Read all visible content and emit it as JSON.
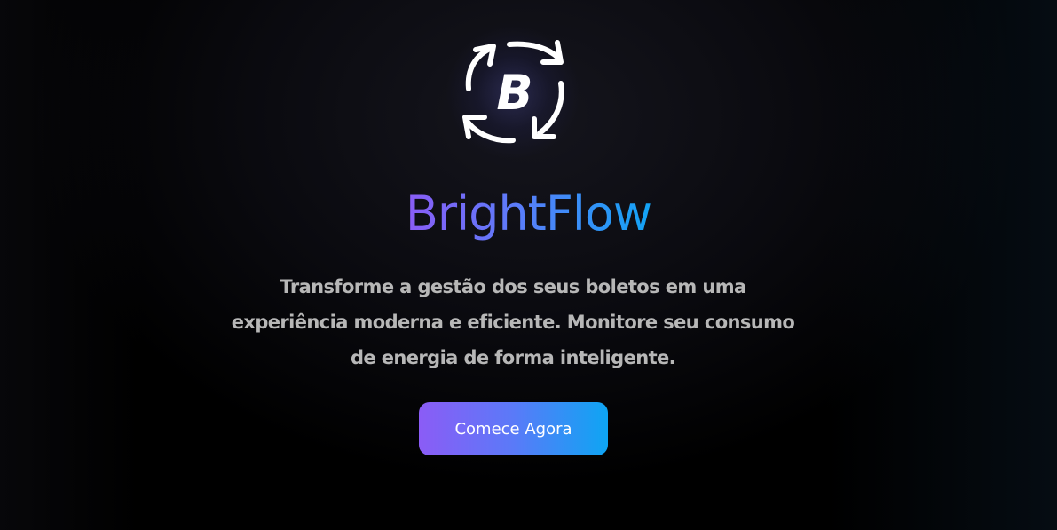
{
  "brand": {
    "logo_letter": "B",
    "logo_icon": "refresh-cycle-icon",
    "name": "BrightFlow"
  },
  "hero": {
    "tagline": "Transforme a gestão dos seus boletos em uma experiência moderna e eficiente. Monitore seu consumo de energia de forma inteligente.",
    "cta_label": "Comece Agora"
  },
  "colors": {
    "background": "#000000",
    "gradient_start": "#8b5cf6",
    "gradient_end": "#0ea5f3",
    "tagline_text": "#b7b7b7",
    "button_text": "#ffffff"
  }
}
